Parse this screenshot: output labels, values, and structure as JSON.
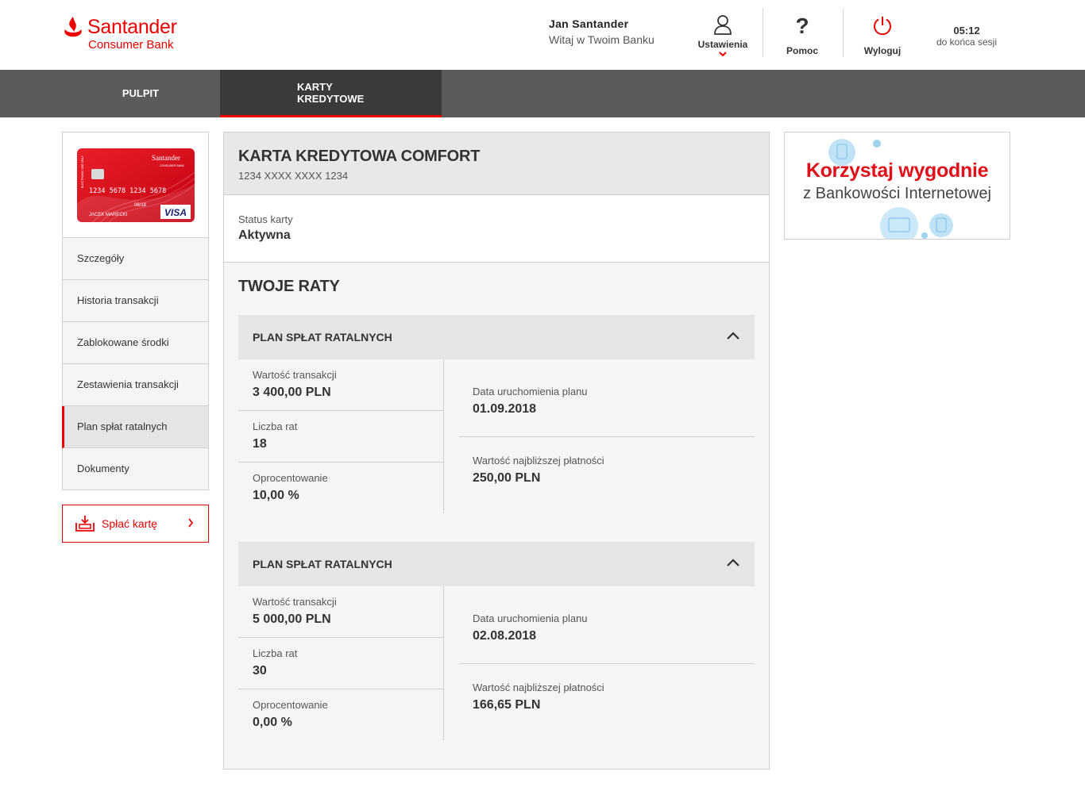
{
  "brand": {
    "name": "Santander",
    "sub": "Consumer Bank",
    "color": "#ec0000"
  },
  "user": {
    "name": "Jan Santander",
    "welcome": "Witaj w Twoim Banku"
  },
  "header_actions": {
    "settings": "Ustawienia",
    "help": "Pomoc",
    "logout": "Wyloguj"
  },
  "session": {
    "time": "05:12",
    "label": "do końca sesji"
  },
  "nav": {
    "tabs": [
      {
        "label": "PULPIT",
        "active": false
      },
      {
        "label": "KARTY KREDYTOWE",
        "active": true
      }
    ]
  },
  "card_image": {
    "brand": "Santander",
    "brand_sub": "CONSUMER BANK",
    "number": "1234  5678  1234  5678",
    "expiry": "06/18",
    "holder": "JACEK MARECKI",
    "network": "VISA",
    "side_text": "ELECTRONIC USE ONLY"
  },
  "sidebar": {
    "items": [
      {
        "label": "Szczegóły",
        "active": false
      },
      {
        "label": "Historia transakcji",
        "active": false
      },
      {
        "label": "Zablokowane środki",
        "active": false
      },
      {
        "label": "Zestawienia transakcji",
        "active": false
      },
      {
        "label": "Plan spłat ratalnych",
        "active": true
      },
      {
        "label": "Dokumenty",
        "active": false
      }
    ],
    "pay_button": "Spłać kartę"
  },
  "card": {
    "title": "KARTA KREDYTOWA COMFORT",
    "number": "1234 XXXX XXXX 1234",
    "status_label": "Status karty",
    "status_value": "Aktywna"
  },
  "installments": {
    "title": "TWOJE RATY",
    "plans": [
      {
        "title": "PLAN SPŁAT RATALNYCH",
        "transaction_label": "Wartość transakcji",
        "transaction_value": "3 400,00 PLN",
        "count_label": "Liczba rat",
        "count_value": "18",
        "rate_label": "Oprocentowanie",
        "rate_value": "10,00 %",
        "start_label": "Data uruchomienia planu",
        "start_value": "01.09.2018",
        "next_label": "Wartość najbliższej płatności",
        "next_value": "250,00 PLN"
      },
      {
        "title": "PLAN SPŁAT RATALNYCH",
        "transaction_label": "Wartość transakcji",
        "transaction_value": "5 000,00 PLN",
        "count_label": "Liczba rat",
        "count_value": "30",
        "rate_label": "Oprocentowanie",
        "rate_value": "0,00 %",
        "start_label": "Data uruchomienia planu",
        "start_value": "02.08.2018",
        "next_label": "Wartość najbliższej płatności",
        "next_value": "166,65 PLN"
      }
    ]
  },
  "banner": {
    "title": "Korzystaj wygodnie",
    "subtitle": "z Bankowości Internetowej"
  }
}
